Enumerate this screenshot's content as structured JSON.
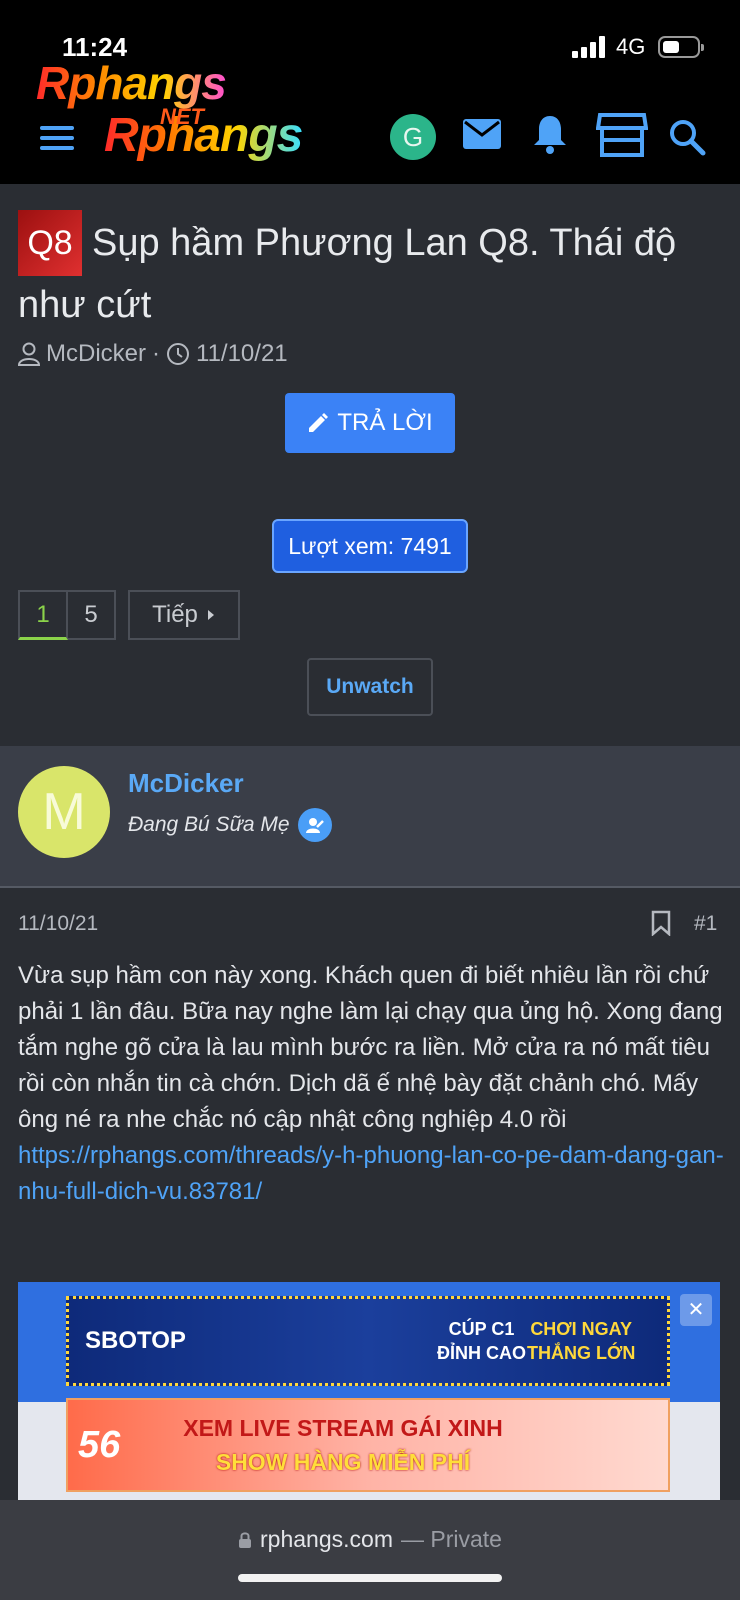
{
  "status": {
    "time": "11:24",
    "network": "4G"
  },
  "header": {
    "logo_top": "Rphangs",
    "logo_net": "NET",
    "logo_main": "Rphangs",
    "avatar_letter": "G",
    "icons": [
      "menu-icon",
      "mail-icon",
      "bell-icon",
      "store-icon",
      "search-icon"
    ]
  },
  "thread": {
    "prefix": "Q8",
    "title": "Sụp hầm Phương Lan Q8. Thái độ như cứt",
    "author": "McDicker",
    "separator": "·",
    "date": "11/10/21",
    "reply_label": "TRẢ LỜI",
    "views_label": "Lượt xem: 7491",
    "pagination": {
      "current": "1",
      "last": "5",
      "next_label": "Tiếp"
    },
    "unwatch_label": "Unwatch"
  },
  "user": {
    "avatar_letter": "M",
    "name": "McDicker",
    "user_title": "Đang Bú Sữa Mẹ"
  },
  "post": {
    "date": "11/10/21",
    "number": "#1",
    "body": "Vừa sụp hầm con này xong. Khách quen đi biết nhiêu lần rồi chứ phải 1 lần đâu. Bữa nay nghe làm lại chạy qua ủng hộ. Xong đang tắm nghe gõ cửa là lau mình bước ra liền. Mở cửa ra nó mất tiêu rồi còn nhắn tin cà chớn. Dịch dã ế nhệ bày đặt chảnh chó. Mấy ông né ra nhe chắc nó cập nhật công nghiệp 4.0 rồi",
    "link": "https://rphangs.com/threads/y-h-phuong-lan-co-pe-dam-dang-gan-nhu-full-dich-vu.83781/"
  },
  "ads": {
    "ad1_brand": "SBOTOP",
    "ad1_cup": "CÚP C1\nĐỈNH CAO",
    "ad1_play": "CHƠI NGAY\nTHẮNG LỚN",
    "ad2_logo": "56",
    "ad2_line1": "XEM LIVE STREAM GÁI XINH",
    "ad2_line2": "SHOW HÀNG MIỄN PHÍ"
  },
  "browser": {
    "domain": "rphangs.com",
    "mode": "— Private"
  },
  "colors": {
    "accent": "#3b82f6",
    "link": "#4fa3f7",
    "active_page": "#8bd34a"
  }
}
